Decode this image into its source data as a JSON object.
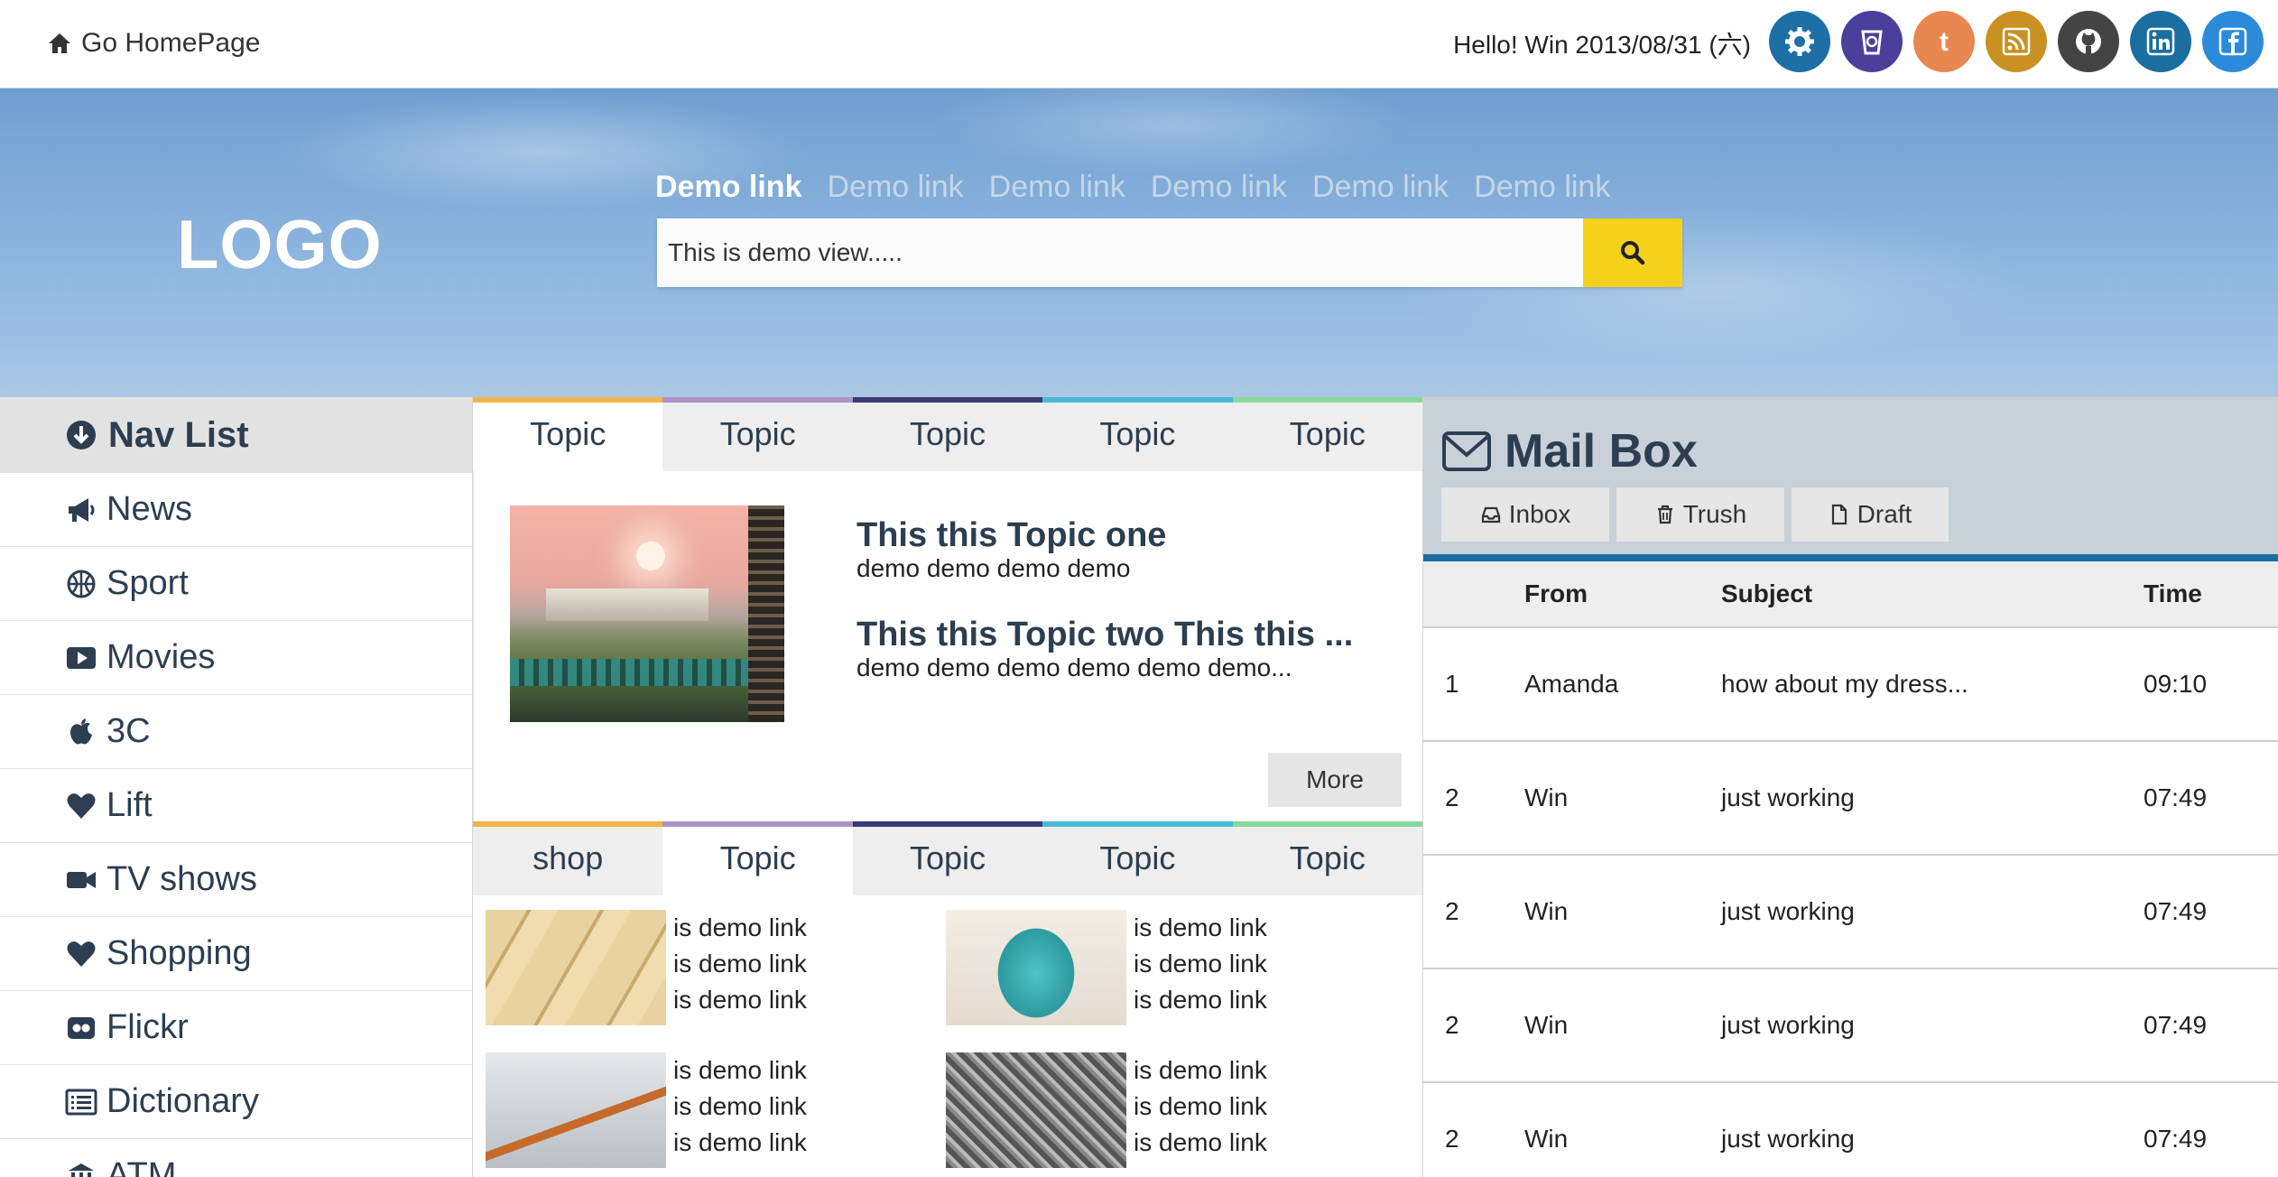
{
  "topbar": {
    "home_label": "Go HomePage",
    "greeting": "Hello! Win 2013/08/31 (六)",
    "social": [
      {
        "name": "settings",
        "color": "#1d6fa6",
        "icon": "gear-icon"
      },
      {
        "name": "lastfm",
        "color": "#4a3f9b",
        "icon": "bucket-icon"
      },
      {
        "name": "tumblr",
        "color": "#e8874f",
        "icon": "tumblr-icon"
      },
      {
        "name": "rss",
        "color": "#c99123",
        "icon": "rss-icon"
      },
      {
        "name": "github",
        "color": "#444444",
        "icon": "github-icon"
      },
      {
        "name": "linkedin",
        "color": "#1b6ea0",
        "icon": "linkedin-icon"
      },
      {
        "name": "facebook",
        "color": "#2c8bd8",
        "icon": "facebook-icon"
      }
    ]
  },
  "hero": {
    "logo": "LOGO",
    "links": [
      "Demo link",
      "Demo link",
      "Demo link",
      "Demo link",
      "Demo link",
      "Demo link"
    ],
    "search_value": "This is demo view.....",
    "search_button_color": "#f5d11c"
  },
  "nav": {
    "title": "Nav List",
    "items": [
      {
        "label": "News",
        "icon": "megaphone-icon"
      },
      {
        "label": "Sport",
        "icon": "basketball-icon"
      },
      {
        "label": "Movies",
        "icon": "play-icon"
      },
      {
        "label": "3C",
        "icon": "apple-icon"
      },
      {
        "label": "Lift",
        "icon": "heart-icon"
      },
      {
        "label": "TV shows",
        "icon": "video-camera-icon"
      },
      {
        "label": "Shopping",
        "icon": "heart-icon"
      },
      {
        "label": "Flickr",
        "icon": "flickr-icon"
      },
      {
        "label": "Dictionary",
        "icon": "list-icon"
      },
      {
        "label": "ATM",
        "icon": "bank-icon"
      }
    ]
  },
  "topics": {
    "tabs": [
      {
        "label": "Topic",
        "color": "#f0b54a"
      },
      {
        "label": "Topic",
        "color": "#a895c6"
      },
      {
        "label": "Topic",
        "color": "#3b3a73"
      },
      {
        "label": "Topic",
        "color": "#49b9d9"
      },
      {
        "label": "Topic",
        "color": "#86d99e"
      }
    ],
    "title_one": "This this Topic one",
    "sub_one": "demo demo demo demo",
    "title_two": "This this Topic two This this ...",
    "sub_two": "demo demo demo demo demo demo...",
    "more_label": "More"
  },
  "shop": {
    "tabs": [
      {
        "label": "shop",
        "color": "#f0b54a"
      },
      {
        "label": "Topic",
        "color": "#a895c6"
      },
      {
        "label": "Topic",
        "color": "#3b3a73"
      },
      {
        "label": "Topic",
        "color": "#49b9d9"
      },
      {
        "label": "Topic",
        "color": "#86d99e"
      }
    ],
    "items": [
      {
        "links": [
          "is demo link",
          "is demo link",
          "is demo link"
        ]
      },
      {
        "links": [
          "is demo link",
          "is demo link",
          "is demo link"
        ]
      },
      {
        "links": [
          "is demo link",
          "is demo link",
          "is demo link"
        ]
      },
      {
        "links": [
          "is demo link",
          "is demo link",
          "is demo link"
        ]
      }
    ]
  },
  "mail": {
    "title": "Mail Box",
    "buttons": {
      "inbox": "Inbox",
      "trash": "Trush",
      "draft": "Draft"
    },
    "columns": {
      "num": "",
      "from": "From",
      "subject": "Subject",
      "time": "Time"
    },
    "rows": [
      {
        "num": "1",
        "from": "Amanda",
        "subject": "how about my dress...",
        "time": "09:10"
      },
      {
        "num": "2",
        "from": "Win",
        "subject": "just working",
        "time": "07:49"
      },
      {
        "num": "2",
        "from": "Win",
        "subject": "just working",
        "time": "07:49"
      },
      {
        "num": "2",
        "from": "Win",
        "subject": "just working",
        "time": "07:49"
      },
      {
        "num": "2",
        "from": "Win",
        "subject": "just working",
        "time": "07:49"
      }
    ],
    "accent": "#1b6ea0"
  }
}
